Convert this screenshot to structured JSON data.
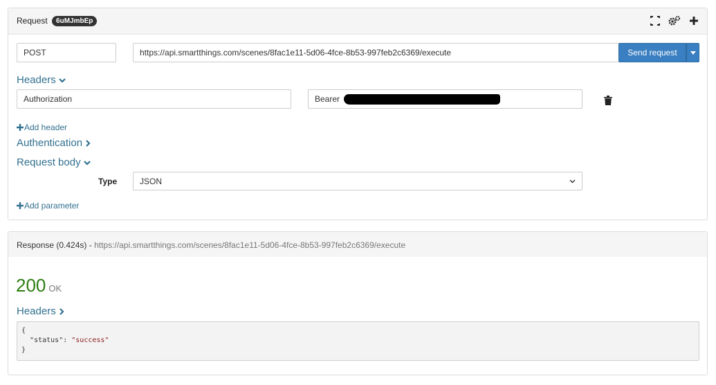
{
  "request": {
    "title": "Request",
    "badge": "6uMJmbEp",
    "method": "POST",
    "url": "https://api.smartthings.com/scenes/8fac1e11-5d06-4fce-8b53-997feb2c6369/execute",
    "send_label": "Send request",
    "headers_title": "Headers",
    "header_name": "Authorization",
    "header_value_prefix": "Bearer",
    "add_header_label": "Add header",
    "auth_title": "Authentication",
    "body_title": "Request body",
    "type_label": "Type",
    "type_value": "JSON",
    "add_param_label": "Add parameter"
  },
  "response": {
    "label": "Response (0.424s) -",
    "url": "https://api.smartthings.com/scenes/8fac1e11-5d06-4fce-8b53-997feb2c6369/execute",
    "status_code": "200",
    "status_text": "OK",
    "headers_title": "Headers",
    "body_open": "{",
    "body_key": "\"status\"",
    "body_sep": ": ",
    "body_value": "\"success\"",
    "body_close": "}"
  },
  "colors": {
    "accent": "#3a7fc1",
    "link": "#31708f",
    "success": "#2d7d12"
  },
  "icons": [
    "expand-icon",
    "gears-icon",
    "plus-icon",
    "caret-down-icon",
    "trash-icon",
    "chevron-down-icon",
    "chevron-right-icon"
  ]
}
